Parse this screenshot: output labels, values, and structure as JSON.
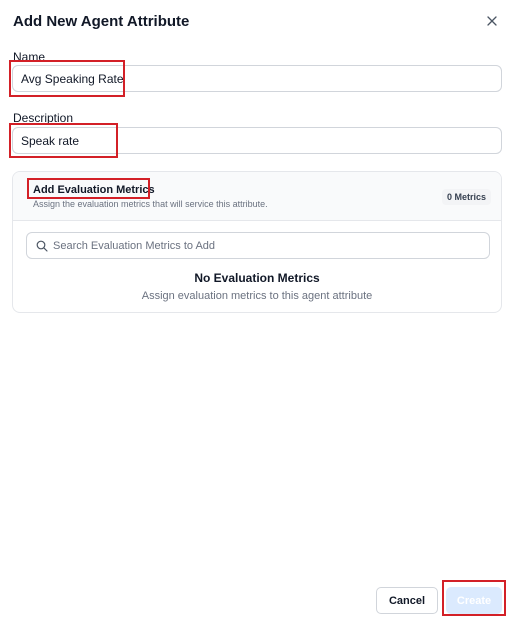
{
  "dialog": {
    "title": "Add New Agent Attribute"
  },
  "name_field": {
    "label": "Name",
    "value": "Avg Speaking Rate"
  },
  "description_field": {
    "label": "Description",
    "value": "Speak rate"
  },
  "metrics": {
    "title": "Add Evaluation Metrics",
    "subtitle": "Assign the evaluation metrics that will service this attribute.",
    "count": "0 Metrics",
    "search_placeholder": "Search Evaluation Metrics to Add",
    "empty_title": "No Evaluation Metrics",
    "empty_subtitle": "Assign evaluation metrics to this agent attribute"
  },
  "footer": {
    "cancel_label": "Cancel",
    "create_label": "Create"
  },
  "colors": {
    "highlight": "#d32027",
    "create_disabled_bg": "#dbeafe"
  }
}
